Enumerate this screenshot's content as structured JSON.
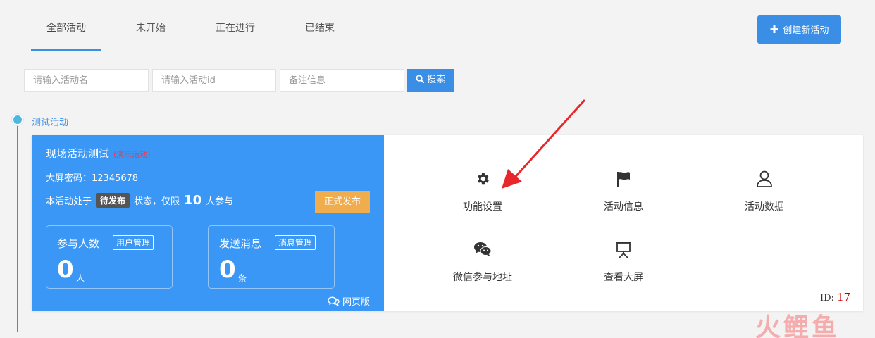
{
  "tabs": [
    {
      "label": "全部活动",
      "active": true
    },
    {
      "label": "未开始",
      "active": false
    },
    {
      "label": "正在进行",
      "active": false
    },
    {
      "label": "已结束",
      "active": false
    }
  ],
  "create_button": {
    "icon": "plus-icon",
    "label": "创建新活动"
  },
  "search": {
    "name_placeholder": "请输入活动名",
    "id_placeholder": "请输入活动id",
    "note_placeholder": "备注信息",
    "button_icon": "search-icon",
    "button_label": "搜索"
  },
  "group": {
    "title": "测试活动"
  },
  "activity": {
    "title": "现场活动测试",
    "demo_tag": "(演示活动)",
    "screen_password": "大屏密码：12345678",
    "status_prefix": "本活动处于",
    "status_badge": "待发布",
    "status_middle": "状态，仅限",
    "limit": "10",
    "status_suffix": "人参与",
    "publish_label": "正式发布",
    "participants": {
      "label": "参与人数",
      "manage": "用户管理",
      "count": "0",
      "unit": "人"
    },
    "messages": {
      "label": "发送消息",
      "manage": "消息管理",
      "count": "0",
      "unit": "条"
    },
    "web_version": "网页版",
    "id_label": "ID:",
    "id_value": "17"
  },
  "functions": [
    {
      "label": "功能设置",
      "icon": "gear-icon"
    },
    {
      "label": "活动信息",
      "icon": "flag-icon"
    },
    {
      "label": "活动数据",
      "icon": "user-icon"
    },
    {
      "label": "微信参与地址",
      "icon": "wechat-icon"
    },
    {
      "label": "查看大屏",
      "icon": "presentation-icon"
    }
  ],
  "watermark": "火鲤鱼",
  "colors": {
    "accent": "#3a8ee6",
    "card": "#3a97f5",
    "publish": "#f0ad4e",
    "arrow": "#e8272c",
    "demo": "#e83a50"
  }
}
